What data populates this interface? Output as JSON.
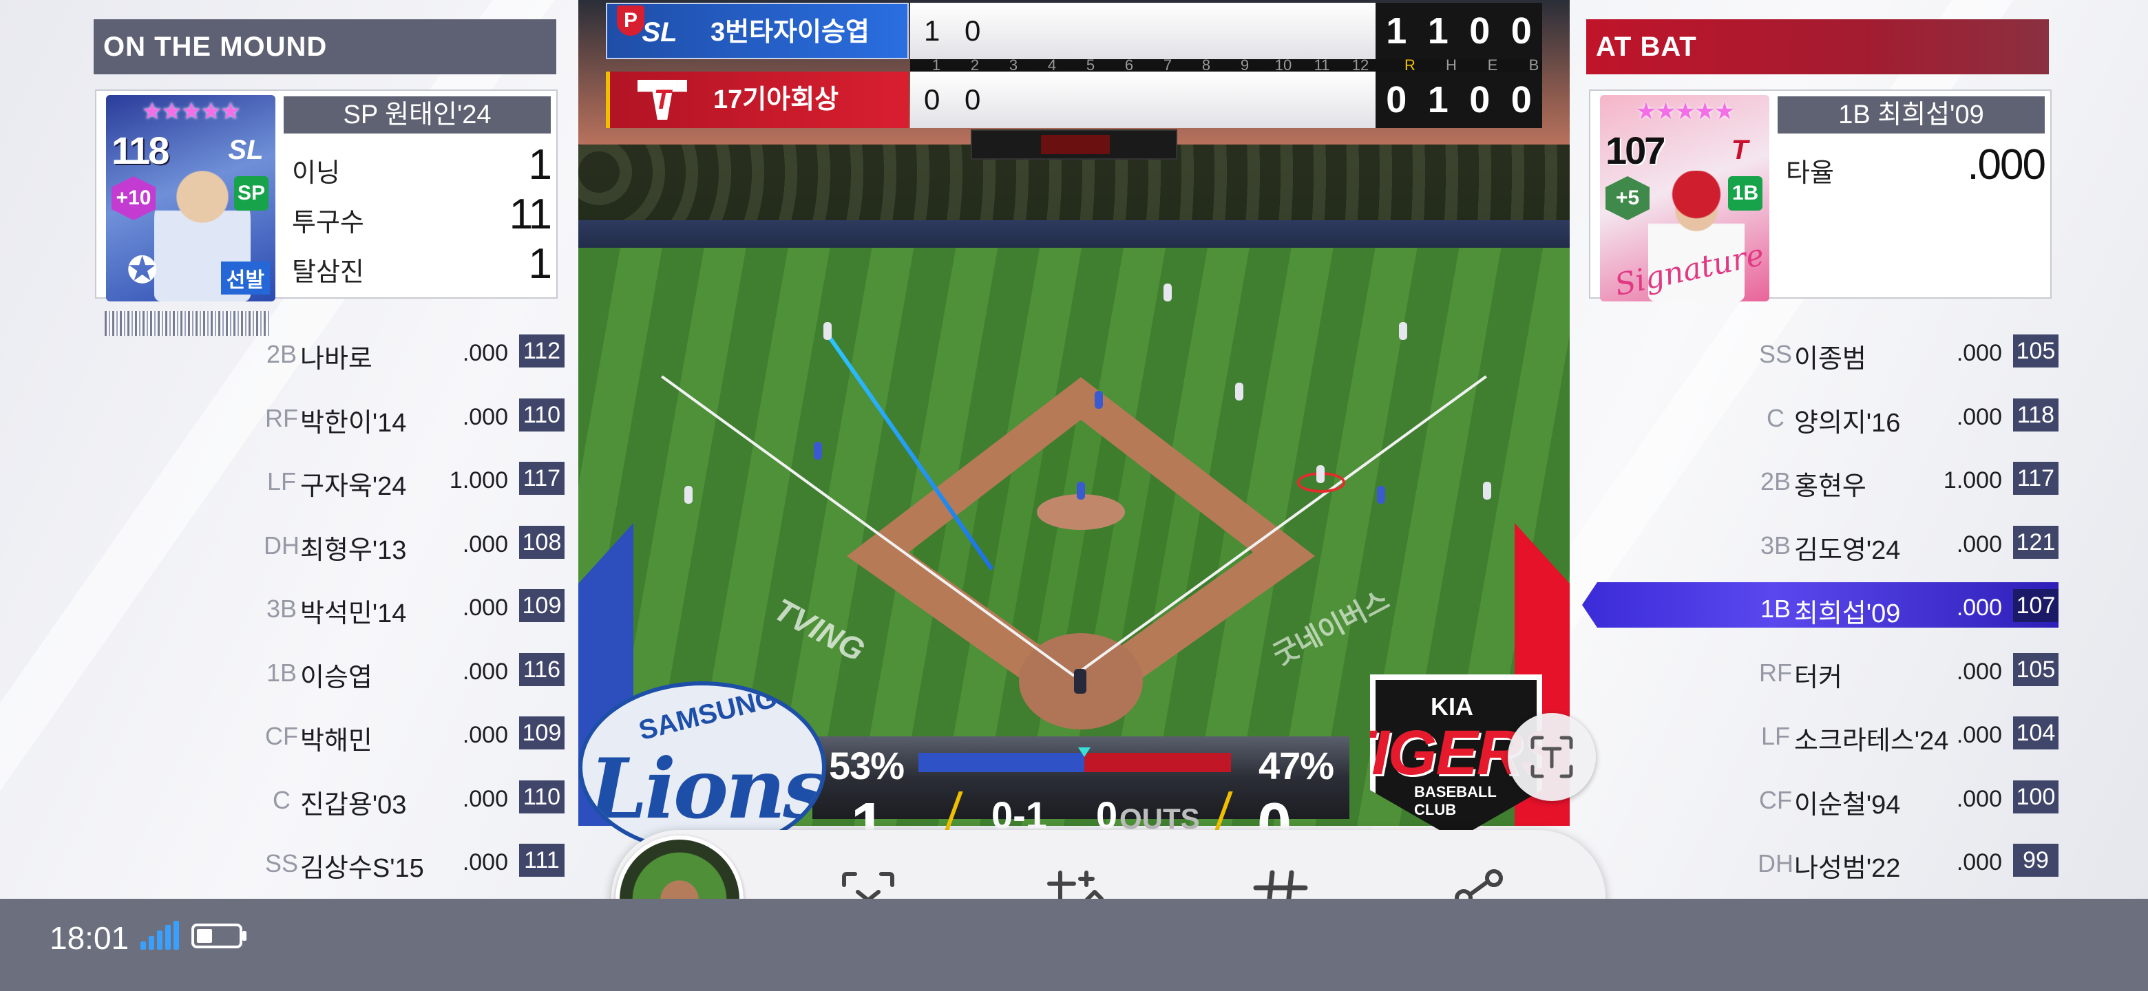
{
  "status_bar": {
    "time": "18:01",
    "signal_icon": "signal-bars-icon",
    "battery_icon": "battery-icon"
  },
  "pitcher_panel": {
    "header": "ON THE MOUND",
    "card": {
      "stars": "★★★★★",
      "overall": "118",
      "enhance": "+10",
      "position_badge": "SP",
      "team_mark": "SL",
      "tag": "선발",
      "title": "SP 원태인'24"
    },
    "stats": [
      {
        "label": "이닝",
        "value": "1"
      },
      {
        "label": "투구수",
        "value": "11"
      },
      {
        "label": "탈삼진",
        "value": "1"
      }
    ]
  },
  "away_lineup": [
    {
      "pos": "2B",
      "name": "나바로",
      "avg": ".000",
      "ovr": "112"
    },
    {
      "pos": "RF",
      "name": "박한이'14",
      "avg": ".000",
      "ovr": "110"
    },
    {
      "pos": "LF",
      "name": "구자욱'24",
      "avg": "1.000",
      "ovr": "117"
    },
    {
      "pos": "DH",
      "name": "최형우'13",
      "avg": ".000",
      "ovr": "108"
    },
    {
      "pos": "3B",
      "name": "박석민'14",
      "avg": ".000",
      "ovr": "109"
    },
    {
      "pos": "1B",
      "name": "이승엽",
      "avg": ".000",
      "ovr": "116"
    },
    {
      "pos": "CF",
      "name": "박해민",
      "avg": ".000",
      "ovr": "109"
    },
    {
      "pos": "C",
      "name": "진갑용'03",
      "avg": ".000",
      "ovr": "110"
    },
    {
      "pos": "SS",
      "name": "김상수S'15",
      "avg": ".000",
      "ovr": "111"
    }
  ],
  "batter_panel": {
    "header": "AT BAT",
    "card": {
      "stars": "★★★★★",
      "overall": "107",
      "enhance": "+5",
      "position_badge": "1B",
      "team_mark": "T",
      "signature": "Signature",
      "title": "1B 최희섭'09"
    },
    "stats": [
      {
        "label": "타율",
        "value": ".000"
      }
    ]
  },
  "home_lineup": [
    {
      "pos": "SS",
      "name": "이종범",
      "avg": ".000",
      "ovr": "105"
    },
    {
      "pos": "C",
      "name": "양의지'16",
      "avg": ".000",
      "ovr": "118"
    },
    {
      "pos": "2B",
      "name": "홍현우",
      "avg": "1.000",
      "ovr": "117"
    },
    {
      "pos": "3B",
      "name": "김도영'24",
      "avg": ".000",
      "ovr": "121"
    },
    {
      "pos": "1B",
      "name": "최희섭'09",
      "avg": ".000",
      "ovr": "107",
      "active": true
    },
    {
      "pos": "RF",
      "name": "터커",
      "avg": ".000",
      "ovr": "105"
    },
    {
      "pos": "LF",
      "name": "소크라테스'24",
      "avg": ".000",
      "ovr": "104"
    },
    {
      "pos": "CF",
      "name": "이순철'94",
      "avg": ".000",
      "ovr": "100"
    },
    {
      "pos": "DH",
      "name": "나성범'22",
      "avg": ".000",
      "ovr": "99"
    }
  ],
  "scoreboard": {
    "away": {
      "label": "3번타자이승엽",
      "logo": "SL",
      "badge": "P",
      "innings": "1 0",
      "r": "1",
      "h": "1",
      "e": "0",
      "b": "0"
    },
    "home": {
      "label": "17기아회상",
      "logo": "T",
      "innings": "0 0",
      "r": "0",
      "h": "1",
      "e": "0",
      "b": "0"
    },
    "columns": [
      "1",
      "2",
      "3",
      "4",
      "5",
      "6",
      "7",
      "8",
      "9",
      "10",
      "11",
      "12",
      "R",
      "H",
      "E",
      "B"
    ]
  },
  "broadcast": {
    "away_pct": "53%",
    "home_pct": "47%",
    "away_score": "1",
    "home_score": "0",
    "count": "0-1",
    "outs": "0",
    "outs_label": "OUTS",
    "win_prob_away": 0.53
  },
  "logos": {
    "lions_top": "SAMSUNG",
    "lions_main": "Lions",
    "tigers_top": "KIA",
    "tigers_main": "TIGERS",
    "tigers_sub": "BASEBALL CLUB"
  },
  "field_text": {
    "left": "TVING",
    "right": "굿네이버스"
  },
  "toolbar": {
    "thumbnail": "screenshot-thumbnail",
    "buttons": [
      {
        "name": "scroll-capture-button",
        "icon": "scroll-capture-icon"
      },
      {
        "name": "crop-edit-button",
        "icon": "crop-draw-icon"
      },
      {
        "name": "tag-button",
        "icon": "hashtag-icon"
      },
      {
        "name": "share-button",
        "icon": "share-icon"
      }
    ]
  },
  "text_extract": {
    "icon": "text-extract-icon"
  }
}
